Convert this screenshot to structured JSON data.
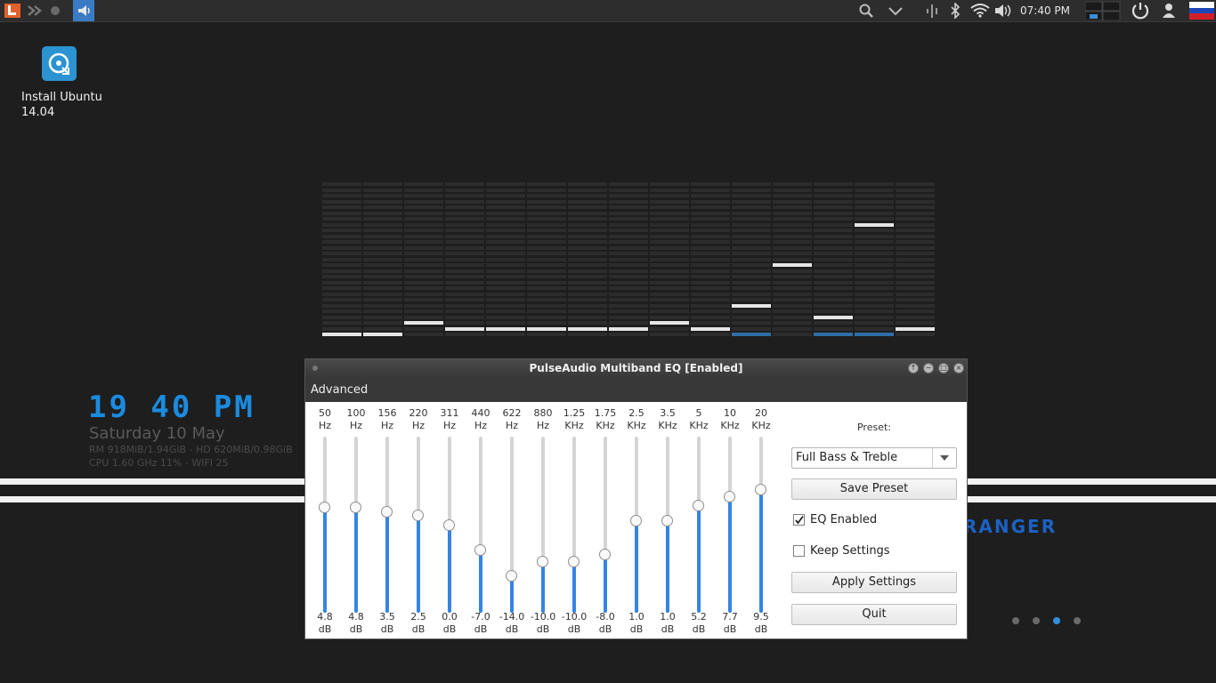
{
  "top_panel": {
    "clock": "07:40 PM",
    "icons": [
      "app-menu-icon",
      "forward-icon",
      "record-icon",
      "pulseaudio-app-icon",
      "search-icon",
      "chevron-down-icon",
      "audio-levels-icon",
      "bluetooth-icon",
      "wifi-icon",
      "volume-icon",
      "workspace-switcher-icon",
      "power-icon",
      "user-icon",
      "russian-flag-icon"
    ]
  },
  "desktop": {
    "icon_label_line1": "Install Ubuntu",
    "icon_label_line2": "14.04"
  },
  "conky": {
    "time": "19 40 PM",
    "date": "Saturday 10 May",
    "stats_line1": "RM 918MiB/1.94GiB - HD 620MiB/0.98GiB",
    "stats_line2": "CPU 1.60 GHz 11% - WIFI 25",
    "brand": "RANGER",
    "brand_color": "#1b62c4",
    "accent_color": "#1b8be0"
  },
  "pager_dots": {
    "count": 4,
    "active_index": 2,
    "active_color": "#2f8fdd"
  },
  "visualizer": {
    "peak_rows": [
      26,
      26,
      24,
      25,
      25,
      25,
      25,
      25,
      24,
      25,
      21,
      14,
      23,
      7,
      25
    ],
    "blue_columns": [
      0,
      1,
      10,
      12,
      13
    ]
  },
  "eq_window": {
    "title": "PulseAudio Multiband EQ [Enabled]",
    "menu": {
      "advanced": "Advanced"
    },
    "bands": [
      {
        "freq": "50",
        "unit": "Hz",
        "gain": "4.8",
        "gain_unit": "dB",
        "value": 4.8
      },
      {
        "freq": "100",
        "unit": "Hz",
        "gain": "4.8",
        "gain_unit": "dB",
        "value": 4.8
      },
      {
        "freq": "156",
        "unit": "Hz",
        "gain": "3.5",
        "gain_unit": "dB",
        "value": 3.5
      },
      {
        "freq": "220",
        "unit": "Hz",
        "gain": "2.5",
        "gain_unit": "dB",
        "value": 2.5
      },
      {
        "freq": "311",
        "unit": "Hz",
        "gain": "0.0",
        "gain_unit": "dB",
        "value": 0.0
      },
      {
        "freq": "440",
        "unit": "Hz",
        "gain": "-7.0",
        "gain_unit": "dB",
        "value": -7.0
      },
      {
        "freq": "622",
        "unit": "Hz",
        "gain": "-14.0",
        "gain_unit": "dB",
        "value": -14.0
      },
      {
        "freq": "880",
        "unit": "Hz",
        "gain": "-10.0",
        "gain_unit": "dB",
        "value": -10.0
      },
      {
        "freq": "1.25",
        "unit": "KHz",
        "gain": "-10.0",
        "gain_unit": "dB",
        "value": -10.0
      },
      {
        "freq": "1.75",
        "unit": "KHz",
        "gain": "-8.0",
        "gain_unit": "dB",
        "value": -8.0
      },
      {
        "freq": "2.5",
        "unit": "KHz",
        "gain": "1.0",
        "gain_unit": "dB",
        "value": 1.0
      },
      {
        "freq": "3.5",
        "unit": "KHz",
        "gain": "1.0",
        "gain_unit": "dB",
        "value": 1.0
      },
      {
        "freq": "5",
        "unit": "KHz",
        "gain": "5.2",
        "gain_unit": "dB",
        "value": 5.2
      },
      {
        "freq": "10",
        "unit": "KHz",
        "gain": "7.7",
        "gain_unit": "dB",
        "value": 7.7
      },
      {
        "freq": "20",
        "unit": "KHz",
        "gain": "9.5",
        "gain_unit": "dB",
        "value": 9.5
      }
    ],
    "preset_label": "Preset:",
    "preset_value": "Full Bass & Treble",
    "save_preset": "Save Preset",
    "eq_enabled": {
      "label": "EQ Enabled",
      "checked": true
    },
    "keep_settings": {
      "label": "Keep Settings",
      "checked": false
    },
    "apply_settings": "Apply Settings",
    "quit": "Quit",
    "slider_color": "#3584e4"
  }
}
